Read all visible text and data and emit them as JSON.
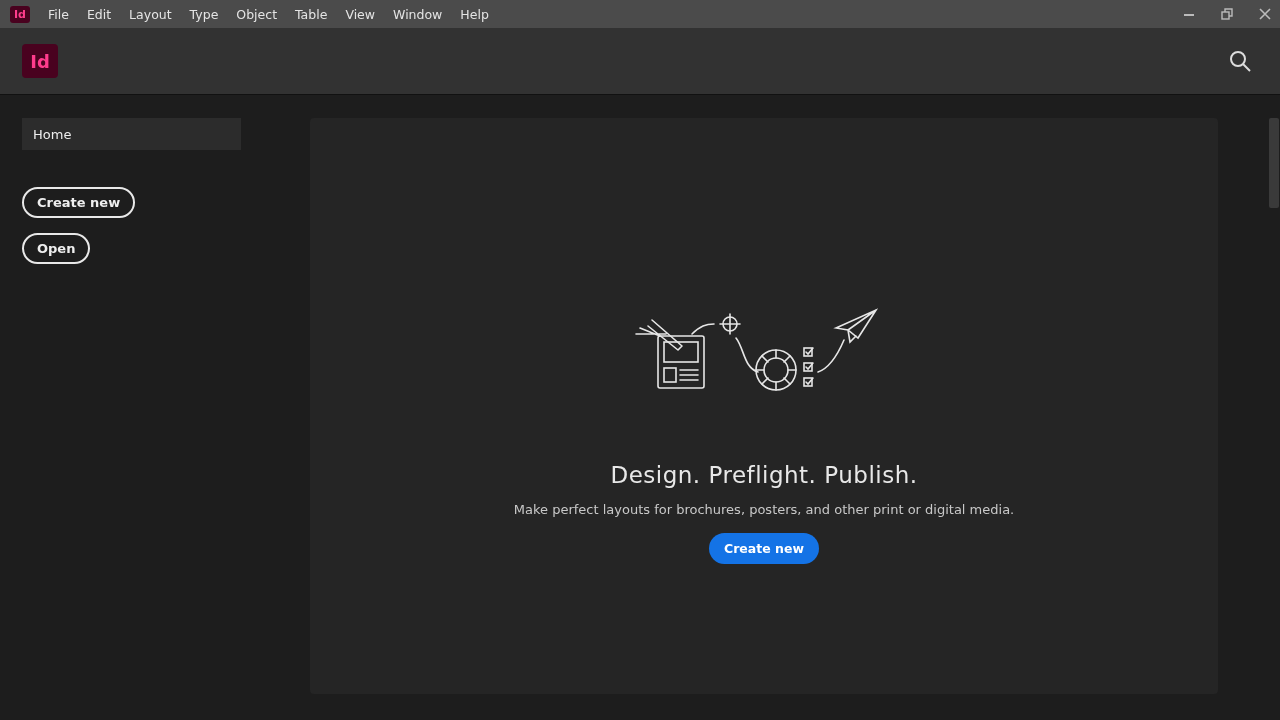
{
  "menu_bar": {
    "app_badge": "Id",
    "items": [
      "File",
      "Edit",
      "Layout",
      "Type",
      "Object",
      "Table",
      "View",
      "Window",
      "Help"
    ]
  },
  "header": {
    "logo": "Id"
  },
  "sidebar": {
    "items": [
      {
        "label": "Home",
        "selected": true
      }
    ],
    "buttons": [
      "Create new",
      "Open"
    ]
  },
  "main": {
    "headline": "Design. Preflight. Publish.",
    "subtitle": "Make perfect layouts for brochures, posters, and other print or digital media.",
    "button": "Create new"
  }
}
